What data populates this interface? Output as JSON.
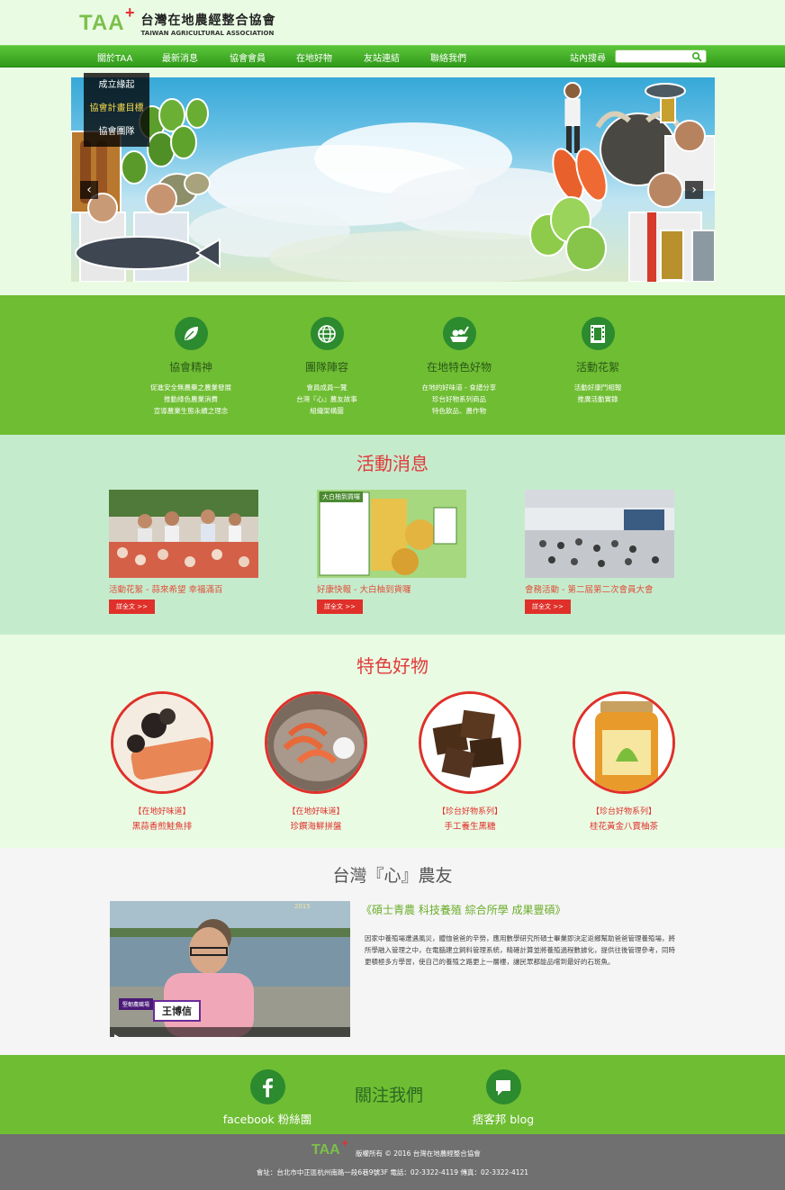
{
  "header": {
    "logo_abbr": "TAA",
    "logo_plus": "+",
    "org_name_zh": "台灣在地農經整合協會",
    "org_name_en": "TAIWAN AGRICULTURAL ASSOCIATION"
  },
  "nav": {
    "items": [
      "關於TAA",
      "最新消息",
      "協會會員",
      "在地好物",
      "友站連結",
      "聯絡我們"
    ],
    "search_label": "站內搜尋",
    "search_placeholder": ""
  },
  "dropdown": {
    "items": [
      "成立緣起",
      "協會計畫目標",
      "協會團隊"
    ],
    "active_index": 1
  },
  "banner": {
    "prev": "‹",
    "next": "›"
  },
  "services": [
    {
      "icon": "leaf-icon",
      "title": "協會精神",
      "lines": [
        "促進安全無農藥之農業發展",
        "推動綠色農業消費",
        "宣導農業生態永續之理念"
      ]
    },
    {
      "icon": "globe-icon",
      "title": "團隊陣容",
      "lines": [
        "會員成員一覽",
        "台灣『心』農友故事",
        "組織架構圖"
      ]
    },
    {
      "icon": "produce-icon",
      "title": "在地特色好物",
      "lines": [
        "在地的好味道 - 食譜分享",
        "珍台好物系列商品",
        "特色飲品、農作物"
      ]
    },
    {
      "icon": "film-icon",
      "title": "活動花絮",
      "lines": [
        "活動好康鬥相報",
        "推廣活動實錄"
      ]
    }
  ],
  "news": {
    "title": "活動消息",
    "more_label": "詳全文 >>",
    "items": [
      {
        "caption": "活動花絮 - 蒜來希望  幸福滿百"
      },
      {
        "caption": "好康快報 - 大白柚到貨囉",
        "img_text": "大白柚到貨囉"
      },
      {
        "caption": "會務活動 - 第二屆第二次會員大會"
      }
    ]
  },
  "products": {
    "title": "特色好物",
    "items": [
      {
        "category": "【在地好味道】",
        "name": "黑蒜香煎鮭魚排"
      },
      {
        "category": "【在地好味道】",
        "name": "珍饌海鮮拼盤"
      },
      {
        "category": "【珍台好物系列】",
        "name": "手工養生黑糖"
      },
      {
        "category": "【珍台好物系列】",
        "name": "桂花黃金八寶柚茶"
      }
    ]
  },
  "farmer": {
    "title": "台灣『心』農友",
    "video_label_small": "堅韌農職場",
    "video_name": "王博信",
    "headline": "《碩士青農 科技養殖 綜合所學 成果豐碩》",
    "body": "因家中養殖場遭遇風災，體恤爸爸的辛勞，應用數學研究所碩士畢業即決定返鄉幫助爸爸管理養殖場，將所學融入管理之中，在電腦建立飼料管理系統，精確計算並將養殖過程數據化，提供往後管理參考，同時更積極多方學習，使自己的養殖之路更上一層樓，讓民眾都能品嚐到最好的石斑魚。"
  },
  "follow": {
    "title": "關注我們",
    "facebook_label": "facebook 粉絲團",
    "blog_label": "痞客邦 blog"
  },
  "footer": {
    "logo_abbr": "TAA",
    "logo_plus": "+",
    "copyright": "版權所有 © 2016 台灣在地農經整合協會",
    "address": "會址：台北市中正區杭州南路一段6巷9號3F   電話：02-3322-4119   傳真：02-3322-4121"
  },
  "colors": {
    "brand_green": "#6fbd33",
    "nav_green": "#3aa924",
    "accent_red": "#e0302a",
    "icon_green": "#2c8a2f"
  }
}
